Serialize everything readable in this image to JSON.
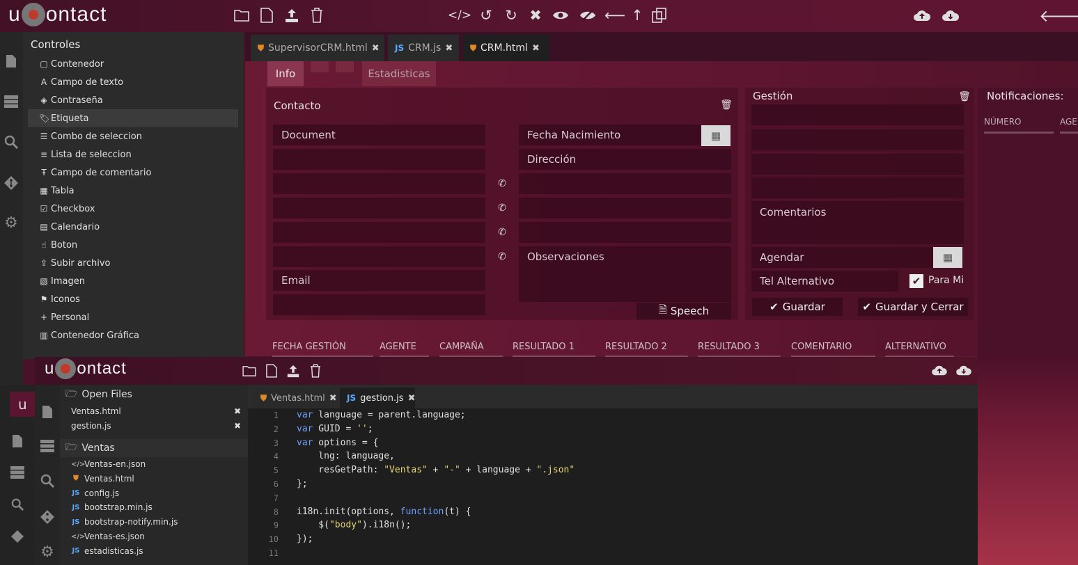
{
  "app": {
    "logo_prefix": "u",
    "logo_suffix": "ontact"
  },
  "toolbar": {
    "file_icons": [
      "folder-icon",
      "file-icon",
      "upload-icon",
      "trash-icon"
    ],
    "edit_icons": [
      "code-icon",
      "undo-icon",
      "redo-icon",
      "close-icon",
      "eye-icon",
      "eye-slash-icon",
      "arrow-left-icon",
      "arrow-up-icon",
      "copy-icon"
    ],
    "cloud_icons": [
      "cloud-upload-icon",
      "cloud-download-icon"
    ],
    "back_icon": "back-arrow-icon"
  },
  "controls": {
    "title": "Controles",
    "items": [
      {
        "label": "Contenedor",
        "icon": "square-icon"
      },
      {
        "label": "Campo de texto",
        "icon": "font-icon"
      },
      {
        "label": "Contraseña",
        "icon": "eye-slash-icon"
      },
      {
        "label": "Etiqueta",
        "icon": "tag-icon"
      },
      {
        "label": "Combo de seleccion",
        "icon": "list-icon"
      },
      {
        "label": "Lista de seleccion",
        "icon": "list-ol-icon"
      },
      {
        "label": "Campo de comentario",
        "icon": "text-height-icon"
      },
      {
        "label": "Tabla",
        "icon": "grid-icon"
      },
      {
        "label": "Checkbox",
        "icon": "check-square-icon"
      },
      {
        "label": "Calendario",
        "icon": "calendar-icon"
      },
      {
        "label": "Boton",
        "icon": "hand-pointer-icon"
      },
      {
        "label": "Subir archivo",
        "icon": "upload-icon"
      },
      {
        "label": "Imagen",
        "icon": "image-icon"
      },
      {
        "label": "Iconos",
        "icon": "flag-icon"
      },
      {
        "label": "Personal",
        "icon": "plus-icon"
      },
      {
        "label": "Contenedor Gráfica",
        "icon": "bar-chart-icon"
      }
    ],
    "active_index": 3
  },
  "file_tabs": [
    {
      "label": "SupervisorCRM.html",
      "type": "html",
      "active": false
    },
    {
      "label": "CRM.js",
      "type": "js",
      "active": false
    },
    {
      "label": "CRM.html",
      "type": "html",
      "active": true
    }
  ],
  "form": {
    "tabs": [
      {
        "label": "Info",
        "active": true
      },
      {
        "label": "Estadisticas",
        "active": false
      }
    ],
    "contacto": {
      "title": "Contacto",
      "document": "Document",
      "fecha_nacimiento": "Fecha Nacimiento",
      "direccion": "Dirección",
      "observaciones": "Observaciones",
      "email": "Email",
      "speech_button": "Speech"
    },
    "gestion": {
      "title": "Gestión",
      "comentarios": "Comentarios",
      "agendar": "Agendar",
      "tel_alternativo": "Tel Alternativo",
      "para_mi_label": "Para Mi",
      "para_mi_checked": true,
      "guardar": "Guardar",
      "guardar_cerrar": "Guardar y Cerrar"
    },
    "notificaciones": {
      "title": "Notificaciones:",
      "columns": [
        "NÚMERO",
        "AGE"
      ]
    },
    "history_columns": [
      "FECHA GESTIÓN",
      "AGENTE",
      "CAMPAÑA",
      "RESULTADO 1",
      "RESULTADO 2",
      "RESULTADO 3",
      "COMENTARIO",
      "ALTERNATIVO"
    ]
  },
  "editor": {
    "logo_prefix": "u",
    "logo_suffix": "ontact",
    "open_files_title": "Open Files",
    "open_files": [
      "Ventas.html",
      "gestion.js"
    ],
    "folder_title": "Ventas",
    "folder_files": [
      {
        "name": "Ventas-en.json",
        "type": "json"
      },
      {
        "name": "Ventas.html",
        "type": "html"
      },
      {
        "name": "config.js",
        "type": "js"
      },
      {
        "name": "bootstrap.min.js",
        "type": "js"
      },
      {
        "name": "bootstrap-notify.min.js",
        "type": "js"
      },
      {
        "name": "Ventas-es.json",
        "type": "json"
      },
      {
        "name": "estadisticas.js",
        "type": "js"
      }
    ],
    "tabs": [
      {
        "label": "Ventas.html",
        "type": "html",
        "active": false
      },
      {
        "label": "gestion.js",
        "type": "js",
        "active": true
      }
    ],
    "code_lines": [
      "var language = parent.language;",
      "var GUID = '';",
      "var options = {",
      "    lng: language,",
      "    resGetPath: \"Ventas\" + \"-\" + language + \".json\"",
      "};",
      "",
      "i18n.init(options, function(t) {",
      "    $(\"body\").i18n();",
      "});",
      ""
    ]
  }
}
